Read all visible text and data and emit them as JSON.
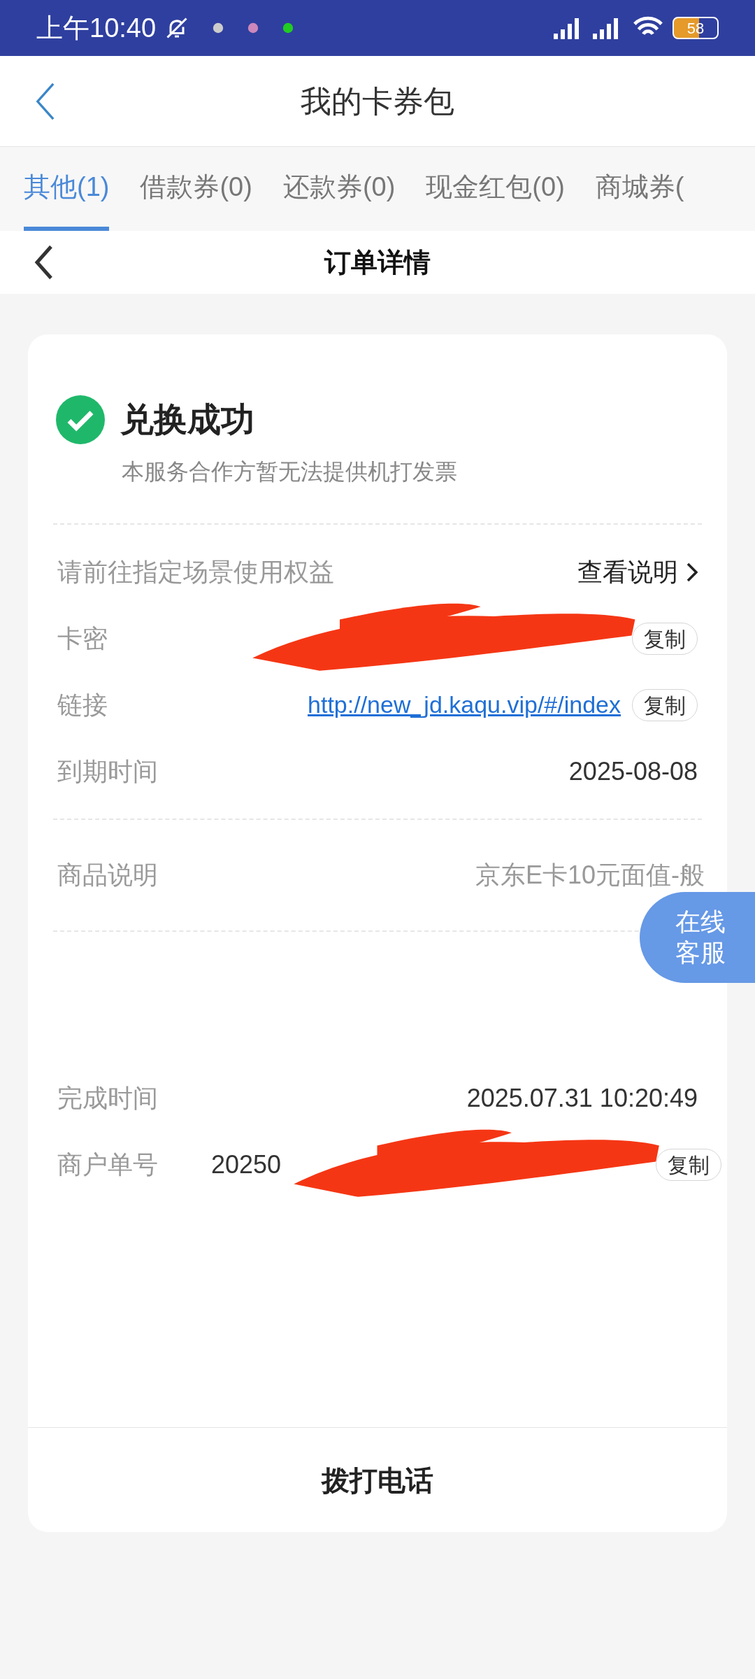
{
  "status_bar": {
    "time": "上午10:40",
    "battery": "58"
  },
  "header": {
    "title": "我的卡券包"
  },
  "tabs": [
    {
      "label": "其他(1)",
      "selected": true
    },
    {
      "label": "借款券(0)",
      "selected": false
    },
    {
      "label": "还款券(0)",
      "selected": false
    },
    {
      "label": "现金红包(0)",
      "selected": false
    },
    {
      "label": "商城券(",
      "selected": false
    }
  ],
  "sub_header": {
    "title": "订单详情"
  },
  "result": {
    "title": "兑换成功",
    "note": "本服务合作方暂无法提供机打发票"
  },
  "usage": {
    "label": "请前往指定场景使用权益",
    "link": "查看说明"
  },
  "fields": [
    {
      "label": "卡密",
      "kind": "redacted",
      "copy": "复制"
    },
    {
      "label": "链接",
      "value": "http://new_jd.kaqu.vip/#/index",
      "kind": "link",
      "copy": "复制"
    },
    {
      "label": "到期时间",
      "value": "2025-08-08",
      "kind": "plain"
    }
  ],
  "product": {
    "label": "商品说明",
    "value": "京东E卡10元面值-般"
  },
  "details": [
    {
      "label": "完成时间",
      "value": "2025.07.31 10:20:49",
      "kind": "plain"
    },
    {
      "label": "商户单号",
      "value": "20250",
      "kind": "redacted",
      "copy": "复制"
    }
  ],
  "call_button": "拨打电话",
  "service_button": {
    "line1": "在线",
    "line2": "客服"
  }
}
